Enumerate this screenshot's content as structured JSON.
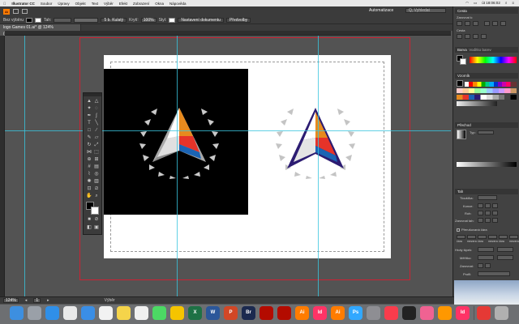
{
  "menubar": {
    "app": "Illustrator CC",
    "items": [
      "Soubor",
      "Úpravy",
      "Objekt",
      "Text",
      "Výběr",
      "Efekt",
      "Zobrazení",
      "Okna",
      "Nápověda"
    ],
    "clock": "út 18:06:02"
  },
  "control": {
    "selection_label": "Bez výběru",
    "stroke_label": "Tah:",
    "style_label": "5 b. Kulatý",
    "opacity_label": "Krytí:",
    "opacity_value": "100%",
    "styl_label": "Styl:",
    "doc_setup": "Nastavení dokumentu",
    "prefs": "Předvolby",
    "workspace": "Automatizace",
    "search_placeholder": "Q, Vyhledat"
  },
  "document_tab": "logo Games 01.ai* @ 124% (CMYK/Náhled)",
  "statusbar": {
    "zoom": "124%",
    "artboard": "1",
    "mode": "Výběr"
  },
  "panels": {
    "properties": "Cesta",
    "align_label": "Zarovnat k:",
    "pathfinder": "Cesta",
    "color": "Barva",
    "color_guide": "Vodítko barev",
    "swatches": "Vzorník",
    "gradient": "Přechod",
    "type_label": "Typ:",
    "stroke": "Tah",
    "weight_label": "Tloušťka:",
    "cap_label": "Konce:",
    "corner_label": "Roh:",
    "align_stroke": "Zarovnat tah:",
    "dashed": "Přerušovaná čára",
    "dash_labels": [
      "čára",
      "mezera",
      "čára",
      "mezera",
      "čára",
      "mezera"
    ],
    "arrowheads": "Hroty šipek:",
    "scale_label": "Měřítko:",
    "align_label2": "Zarovnat:",
    "profile_label": "Profil:"
  },
  "dock": {
    "apps": [
      "Finder",
      "Launchpad",
      "Safari",
      "Chrome",
      "Mail",
      "Calendar",
      "Notes",
      "Photos",
      "Messages",
      "Duck",
      "Excel",
      "Word",
      "PowerPoint",
      "Bridge",
      "Acrobat",
      "Acrobat DC",
      "Illustrator",
      "InDesign",
      "Illustrator 2",
      "Photoshop",
      "System",
      "Music",
      "Fender",
      "Mixer",
      "Cone",
      "InDesign 2",
      "Tower",
      "Trash"
    ],
    "labels": [
      "",
      "",
      "",
      "",
      "",
      "",
      "",
      "",
      "",
      "",
      "X",
      "W",
      "P",
      "Br",
      "",
      "",
      "Ai",
      "Id",
      "Ai",
      "Ps",
      "",
      "",
      "",
      "",
      "",
      "Id",
      "",
      ""
    ]
  },
  "colors": {
    "logo_orange": "#e78a1e",
    "logo_red": "#e63329",
    "logo_blue": "#1b64b4",
    "logo_purple": "#2c1c72",
    "guide": "#39c6de",
    "bleed": "#cc2233"
  }
}
